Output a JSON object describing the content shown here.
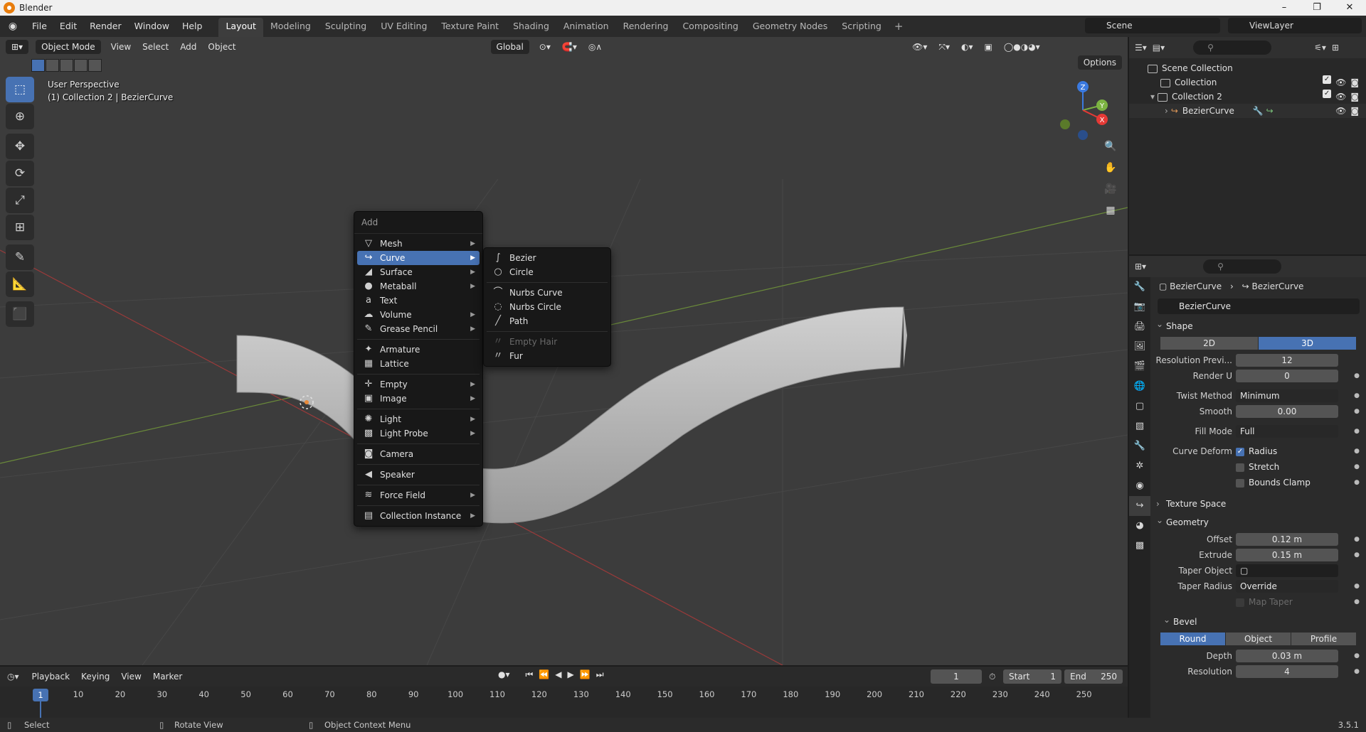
{
  "window": {
    "title": "Blender"
  },
  "menubar": {
    "menus": [
      "File",
      "Edit",
      "Render",
      "Window",
      "Help"
    ],
    "workspaces": [
      "Layout",
      "Modeling",
      "Sculpting",
      "UV Editing",
      "Texture Paint",
      "Shading",
      "Animation",
      "Rendering",
      "Compositing",
      "Geometry Nodes",
      "Scripting"
    ],
    "active_workspace": "Layout",
    "add_workspace": "+",
    "scene": "Scene",
    "view_layer": "ViewLayer"
  },
  "viewport": {
    "mode": "Object Mode",
    "header_menus": [
      "View",
      "Select",
      "Add",
      "Object"
    ],
    "orientation": "Global",
    "options_label": "Options",
    "info_line1": "User Perspective",
    "info_line2": "(1) Collection 2 | BezierCurve",
    "gizmo_axes": {
      "z": "Z",
      "y": "Y",
      "x": "X"
    }
  },
  "add_menu": {
    "title": "Add",
    "items": [
      {
        "label": "Mesh",
        "icon": "mesh-icon",
        "submenu": true
      },
      {
        "label": "Curve",
        "icon": "curve-icon",
        "submenu": true,
        "active": true
      },
      {
        "label": "Surface",
        "icon": "surface-icon",
        "submenu": true
      },
      {
        "label": "Metaball",
        "icon": "metaball-icon",
        "submenu": true
      },
      {
        "label": "Text",
        "icon": "text-icon",
        "submenu": false
      },
      {
        "label": "Volume",
        "icon": "volume-icon",
        "submenu": true
      },
      {
        "label": "Grease Pencil",
        "icon": "grease-pencil-icon",
        "submenu": true
      },
      {
        "label": "Armature",
        "icon": "armature-icon",
        "submenu": false
      },
      {
        "label": "Lattice",
        "icon": "lattice-icon",
        "submenu": false
      },
      {
        "label": "Empty",
        "icon": "empty-icon",
        "submenu": true
      },
      {
        "label": "Image",
        "icon": "image-icon",
        "submenu": true
      },
      {
        "label": "Light",
        "icon": "light-icon",
        "submenu": true
      },
      {
        "label": "Light Probe",
        "icon": "light-probe-icon",
        "submenu": true
      },
      {
        "label": "Camera",
        "icon": "camera-icon",
        "submenu": false
      },
      {
        "label": "Speaker",
        "icon": "speaker-icon",
        "submenu": false
      },
      {
        "label": "Force Field",
        "icon": "force-field-icon",
        "submenu": true
      },
      {
        "label": "Collection Instance",
        "icon": "collection-instance-icon",
        "submenu": true
      }
    ]
  },
  "curve_submenu": {
    "items": [
      {
        "label": "Bezier",
        "icon": "bezier-icon"
      },
      {
        "label": "Circle",
        "icon": "circle-curve-icon"
      },
      {
        "label": "Nurbs Curve",
        "icon": "nurbs-curve-icon"
      },
      {
        "label": "Nurbs Circle",
        "icon": "nurbs-circle-icon"
      },
      {
        "label": "Path",
        "icon": "path-icon"
      },
      {
        "label": "Empty Hair",
        "icon": "empty-hair-icon",
        "disabled": true
      },
      {
        "label": "Fur",
        "icon": "fur-icon"
      }
    ]
  },
  "outliner": {
    "rows": [
      {
        "label": "Scene Collection",
        "depth": 0
      },
      {
        "label": "Collection",
        "depth": 1,
        "checked": true
      },
      {
        "label": "Collection 2",
        "depth": 1,
        "checked": true,
        "expanded": true
      },
      {
        "label": "BezierCurve",
        "depth": 2
      }
    ]
  },
  "properties": {
    "breadcrumb_object": "BezierCurve",
    "breadcrumb_data": "BezierCurve",
    "data_name": "BezierCurve",
    "shape_panel": "Shape",
    "dims": [
      "2D",
      "3D"
    ],
    "active_dim": "3D",
    "resolution_preview_label": "Resolution Previ...",
    "resolution_preview": "12",
    "render_u_label": "Render U",
    "render_u": "0",
    "twist_method_label": "Twist Method",
    "twist_method": "Minimum",
    "smooth_label": "Smooth",
    "smooth": "0.00",
    "fill_mode_label": "Fill Mode",
    "fill_mode": "Full",
    "curve_deform_label": "Curve Deform",
    "radius_label": "Radius",
    "radius_checked": true,
    "stretch_label": "Stretch",
    "bounds_clamp_label": "Bounds Clamp",
    "texture_space_panel": "Texture Space",
    "geometry_panel": "Geometry",
    "offset_label": "Offset",
    "offset": "0.12 m",
    "extrude_label": "Extrude",
    "extrude": "0.15 m",
    "taper_object_label": "Taper Object",
    "taper_radius_label": "Taper Radius",
    "taper_radius": "Override",
    "map_taper_label": "Map Taper",
    "bevel_panel": "Bevel",
    "bevel_modes": [
      "Round",
      "Object",
      "Profile"
    ],
    "active_bevel_mode": "Round",
    "depth_label": "Depth",
    "depth": "0.03 m",
    "resolution_label": "Resolution",
    "resolution": "4"
  },
  "timeline": {
    "menus": [
      "Playback",
      "Keying",
      "View",
      "Marker"
    ],
    "current_frame": "1",
    "start_label": "Start",
    "start": "1",
    "end_label": "End",
    "end": "250",
    "ruler_ticks": [
      "10",
      "20",
      "30",
      "40",
      "50",
      "60",
      "70",
      "80",
      "90",
      "100",
      "110",
      "120",
      "130",
      "140",
      "150",
      "160",
      "170",
      "180",
      "190",
      "200",
      "210",
      "220",
      "230",
      "240",
      "250"
    ]
  },
  "statusbar": {
    "select": "Select",
    "rotate_view": "Rotate View",
    "context_menu": "Object Context Menu",
    "version": "3.5.1"
  }
}
